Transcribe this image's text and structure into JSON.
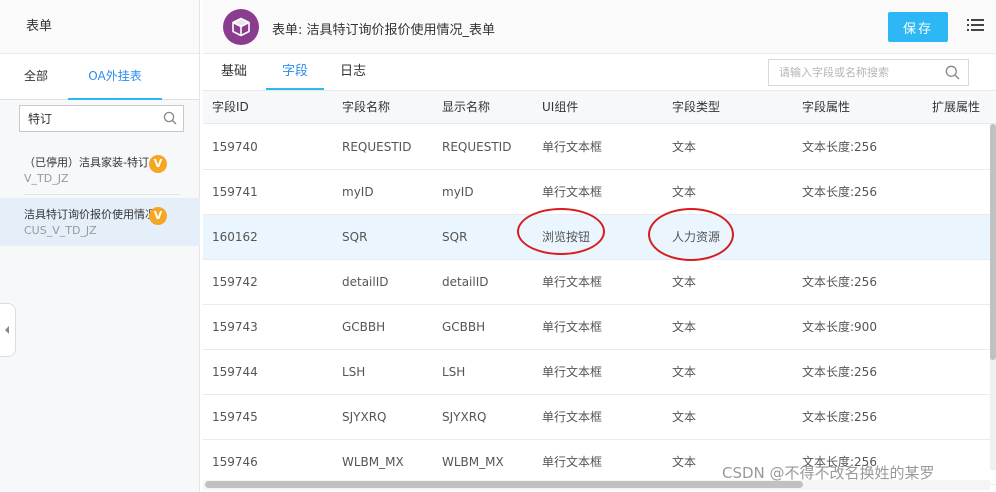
{
  "sidebar": {
    "title": "表单",
    "tabs": [
      {
        "label": "全部"
      },
      {
        "label": "OA外挂表"
      }
    ],
    "search_value": "特订",
    "items": [
      {
        "name": "（已停用）洁具家装-特订...",
        "sub": "V_TD_JZ",
        "badge": "V"
      },
      {
        "name": "洁具特订询价报价使用情况...",
        "sub": "CUS_V_TD_JZ",
        "badge": "V"
      }
    ]
  },
  "header": {
    "title": "表单: 洁具特订询价报价使用情况_表单",
    "save_label": "保存"
  },
  "tabs": [
    {
      "label": "基础"
    },
    {
      "label": "字段"
    },
    {
      "label": "日志"
    }
  ],
  "field_search": {
    "placeholder": "请输入字段或名称搜索"
  },
  "table": {
    "columns": [
      "字段ID",
      "字段名称",
      "显示名称",
      "UI组件",
      "字段类型",
      "字段属性",
      "扩展属性"
    ],
    "rows": [
      [
        "159740",
        "REQUESTID",
        "REQUESTID",
        "单行文本框",
        "文本",
        "文本长度:256",
        ""
      ],
      [
        "159741",
        "myID",
        "myID",
        "单行文本框",
        "文本",
        "文本长度:256",
        ""
      ],
      [
        "160162",
        "SQR",
        "SQR",
        "浏览按钮",
        "人力资源",
        "",
        ""
      ],
      [
        "159742",
        "detailID",
        "detailID",
        "单行文本框",
        "文本",
        "文本长度:256",
        ""
      ],
      [
        "159743",
        "GCBBH",
        "GCBBH",
        "单行文本框",
        "文本",
        "文本长度:900",
        ""
      ],
      [
        "159744",
        "LSH",
        "LSH",
        "单行文本框",
        "文本",
        "文本长度:256",
        ""
      ],
      [
        "159745",
        "SJYXRQ",
        "SJYXRQ",
        "单行文本框",
        "文本",
        "文本长度:256",
        ""
      ],
      [
        "159746",
        "WLBM_MX",
        "WLBM_MX",
        "单行文本框",
        "文本",
        "文本长度:256",
        ""
      ]
    ]
  },
  "watermark": "CSDN @不得不改名换姓的某罗",
  "colors": {
    "accent": "#2db7f5",
    "badge": "#f5a623",
    "form_icon": "#8a3c8f",
    "annotation": "#d61d1d",
    "row_highlight": "#eaf5fd"
  },
  "icons": [
    "search-icon",
    "cube-icon",
    "list-menu-icon",
    "chevron-left-icon"
  ]
}
